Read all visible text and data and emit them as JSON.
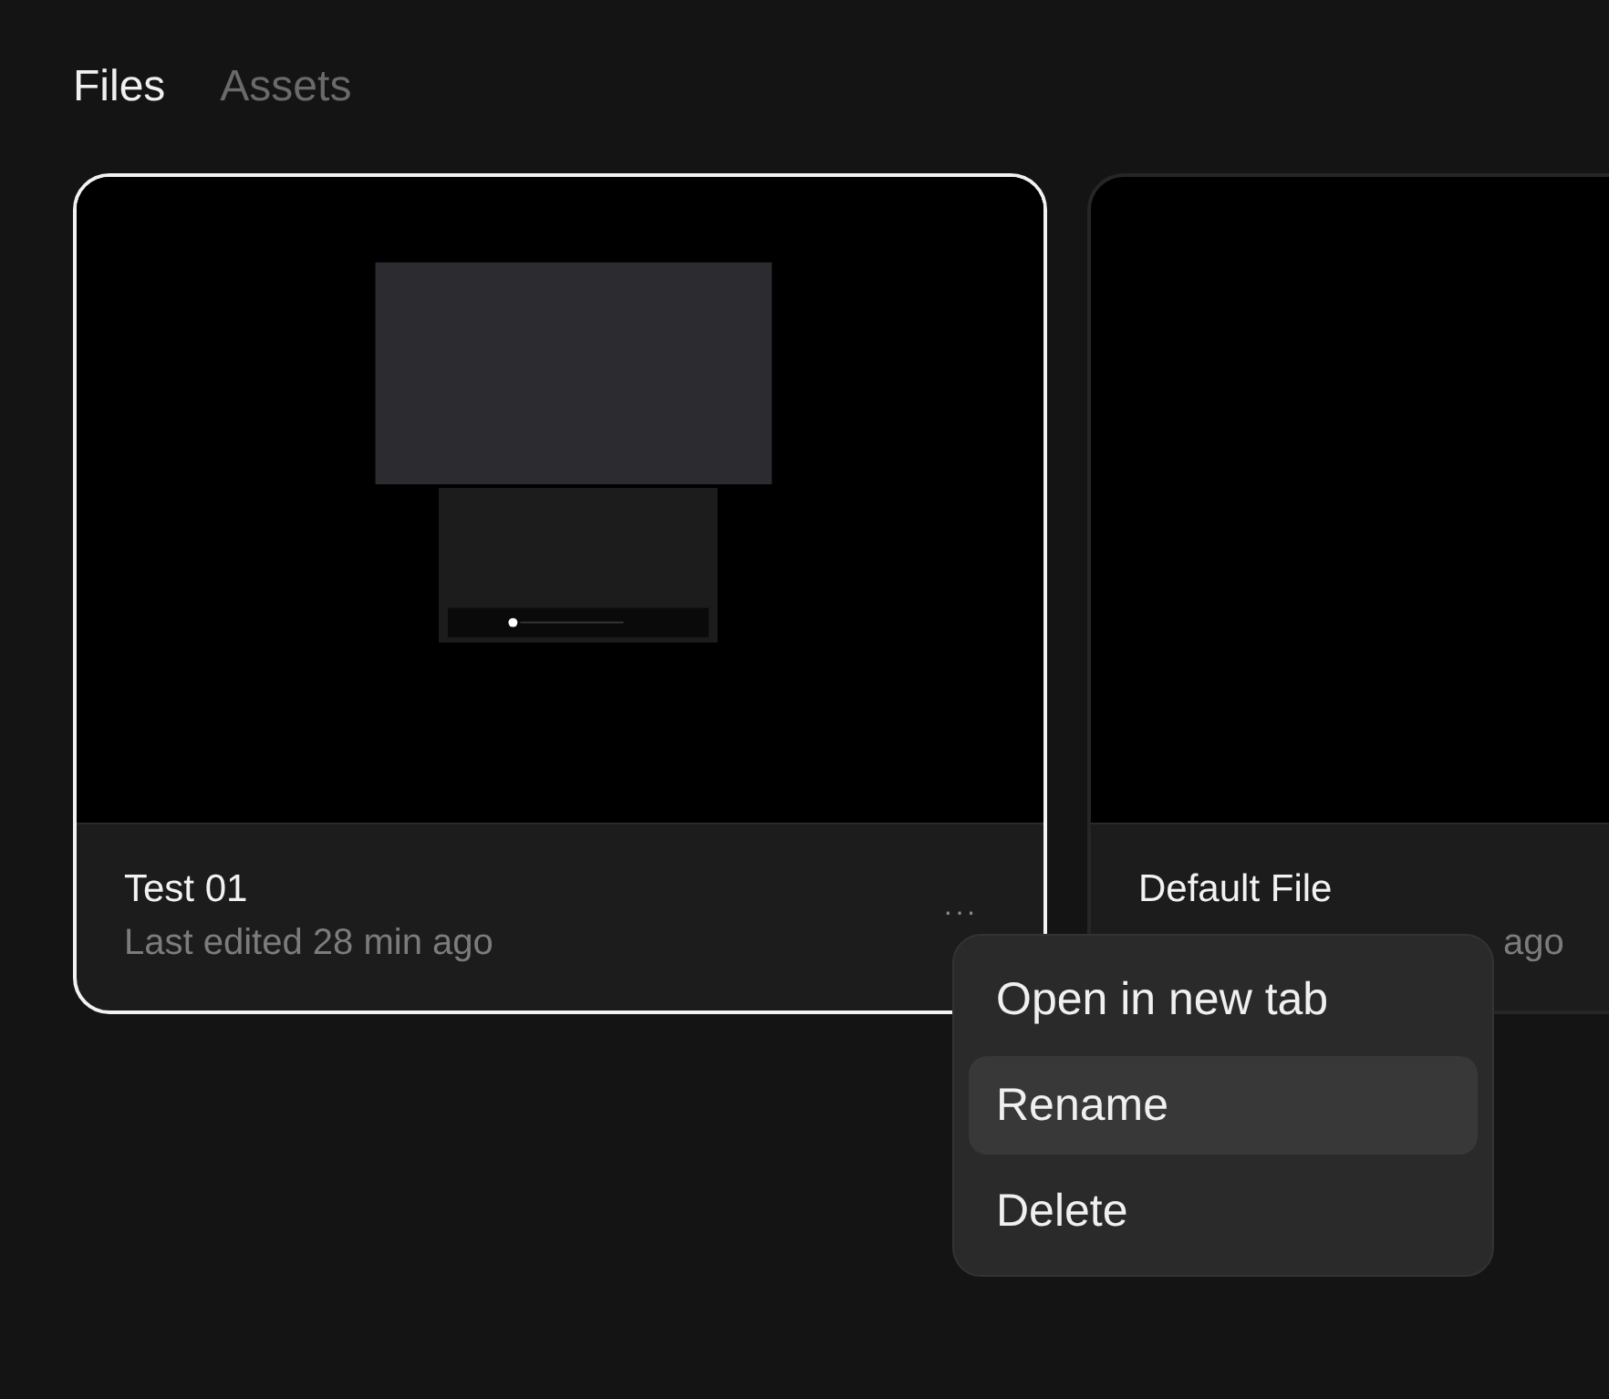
{
  "tabs": [
    {
      "label": "Files",
      "selected": true
    },
    {
      "label": "Assets",
      "selected": false
    }
  ],
  "files": [
    {
      "name": "Test 01",
      "subtitle": "Last edited 28 min ago",
      "selected": true,
      "kind": "design",
      "more": "···"
    },
    {
      "name": "Default File",
      "subtitle": "ago",
      "selected": false,
      "kind": "blank"
    }
  ],
  "context_menu": {
    "items": [
      {
        "label": "Open in new tab",
        "selected": false
      },
      {
        "label": "Rename",
        "selected": true
      },
      {
        "label": "Delete",
        "selected": false
      }
    ]
  }
}
